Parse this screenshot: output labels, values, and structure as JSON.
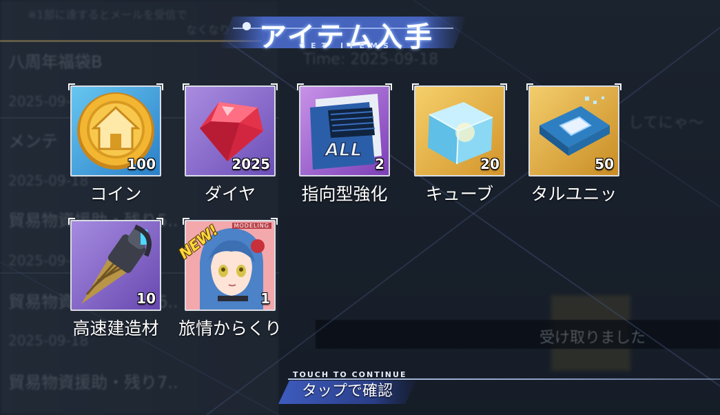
{
  "background": {
    "mail_rows": [
      {
        "subject": "八周年福袋B",
        "date": "2025-09-1"
      },
      {
        "subject": "メンテ",
        "date": "2025-09-18"
      },
      {
        "subject": "貿易物資援助・残り5..",
        "date": "2025-09-1"
      },
      {
        "subject": "貿易物資援助・残り6..",
        "date": "2025-09-18"
      },
      {
        "subject": "貿易物資援助・残り7..",
        "date": ""
      }
    ],
    "notice_top": "※1部に達するとメールを受信で",
    "notice_top2": "なくなり",
    "detail_time": "Time: 2025-09-18",
    "detail_body": "してにゃ～",
    "toast": "受け取りました"
  },
  "header": {
    "title": "アイテム入手",
    "subtitle": "GET ITEMS"
  },
  "items": [
    {
      "name": "コイン",
      "qty": "100",
      "icon": "coin-icon"
    },
    {
      "name": "ダイヤ",
      "qty": "2025",
      "icon": "diamond-icon"
    },
    {
      "name": "指向型強化",
      "qty": "2",
      "icon": "enhancement-ticket-icon"
    },
    {
      "name": "キューブ",
      "qty": "20",
      "icon": "cube-icon"
    },
    {
      "name": "タルユニッ",
      "qty": "50",
      "icon": "chip-icon"
    },
    {
      "name": "高速建造材",
      "qty": "10",
      "icon": "drill-icon"
    },
    {
      "name": "旅情からくり",
      "qty": "1",
      "icon": "character-portrait-icon",
      "badge": "NEW!",
      "tag": "MODELING"
    }
  ],
  "footer": {
    "continue_en": "TOUCH TO CONTINUE",
    "continue_jp": "タップで確認"
  },
  "colors": {
    "coin": "#f3b632",
    "diamond": "#e2334b",
    "cube": "#7fd4f2",
    "frame_gold": "#e8b445",
    "frame_purple": "#8b6fc9",
    "frame_blue": "#4fa7e3",
    "accent": "#7ea6ff"
  }
}
